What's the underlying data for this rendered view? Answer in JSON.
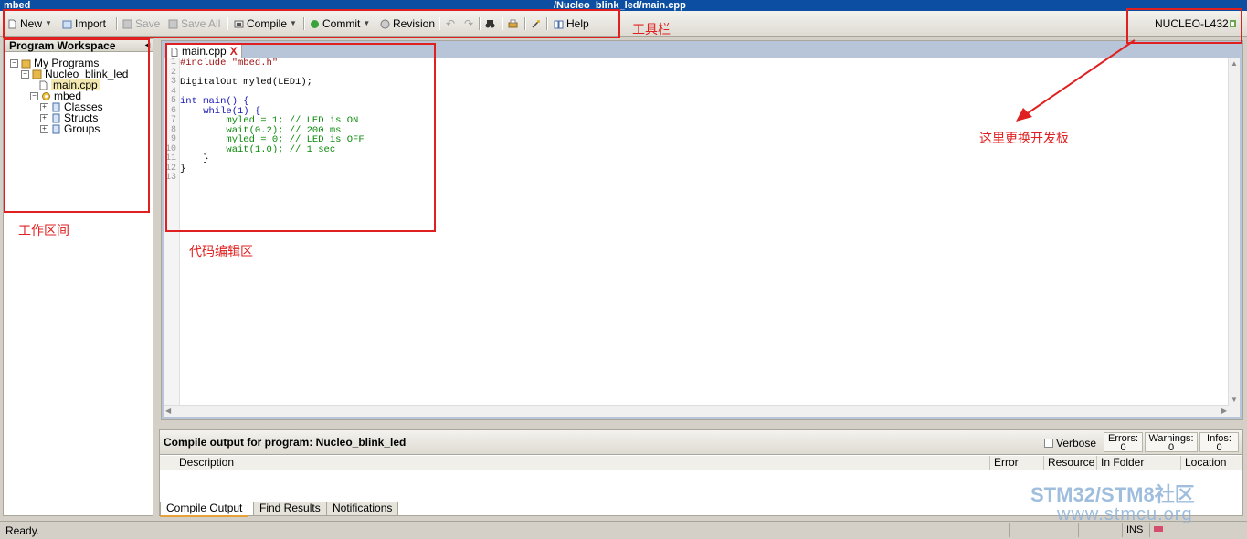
{
  "window": {
    "app_name": "mbed",
    "path": "/Nucleo_blink_led/main.cpp"
  },
  "toolbar": {
    "new": "New",
    "import": "Import",
    "save": "Save",
    "save_all": "Save All",
    "compile": "Compile",
    "commit": "Commit",
    "revision": "Revision",
    "help": "Help",
    "board": "NUCLEO-L432"
  },
  "workspace": {
    "title": "Program Workspace",
    "tree": {
      "root": "My Programs",
      "program": "Nucleo_blink_led",
      "file": "main.cpp",
      "lib": "mbed",
      "lib_children": [
        "Classes",
        "Structs",
        "Groups"
      ]
    }
  },
  "editor": {
    "tab_label": "main.cpp",
    "line_numbers": [
      "1",
      "2",
      "3",
      "4",
      "5",
      "6",
      "7",
      "8",
      "9",
      "10",
      "11",
      "12",
      "13"
    ],
    "code": [
      "#include \"mbed.h\"",
      "",
      "DigitalOut myled(LED1);",
      "",
      "int main() {",
      "    while(1) {",
      "        myled = 1; // LED is ON",
      "        wait(0.2); // 200 ms",
      "        myled = 0; // LED is OFF",
      "        wait(1.0); // 1 sec",
      "    }",
      "}",
      ""
    ]
  },
  "output": {
    "title": "Compile output for program: Nucleo_blink_led",
    "verbose": "Verbose",
    "errors_label": "Errors:",
    "errors_value": "0",
    "warnings_label": "Warnings:",
    "warnings_value": "0",
    "infos_label": "Infos:",
    "infos_value": "0",
    "columns": [
      "Description",
      "Error",
      "Resource",
      "In Folder",
      "Location"
    ],
    "tabs": [
      "Compile Output",
      "Find Results",
      "Notifications"
    ]
  },
  "status": {
    "text": "Ready.",
    "mode": "INS"
  },
  "annotations": {
    "toolbar": "工具栏",
    "workspace": "工作区间",
    "editor": "代码编辑区",
    "board": "这里更换开发板"
  },
  "watermark": {
    "name": "STM32/STM8社区",
    "url": "www.stmcu.org"
  },
  "colors": {
    "annotation": "#e02020",
    "title_bar": "#0b4ea2",
    "keyword": "#1717b8",
    "comment": "#0a8a0a"
  }
}
